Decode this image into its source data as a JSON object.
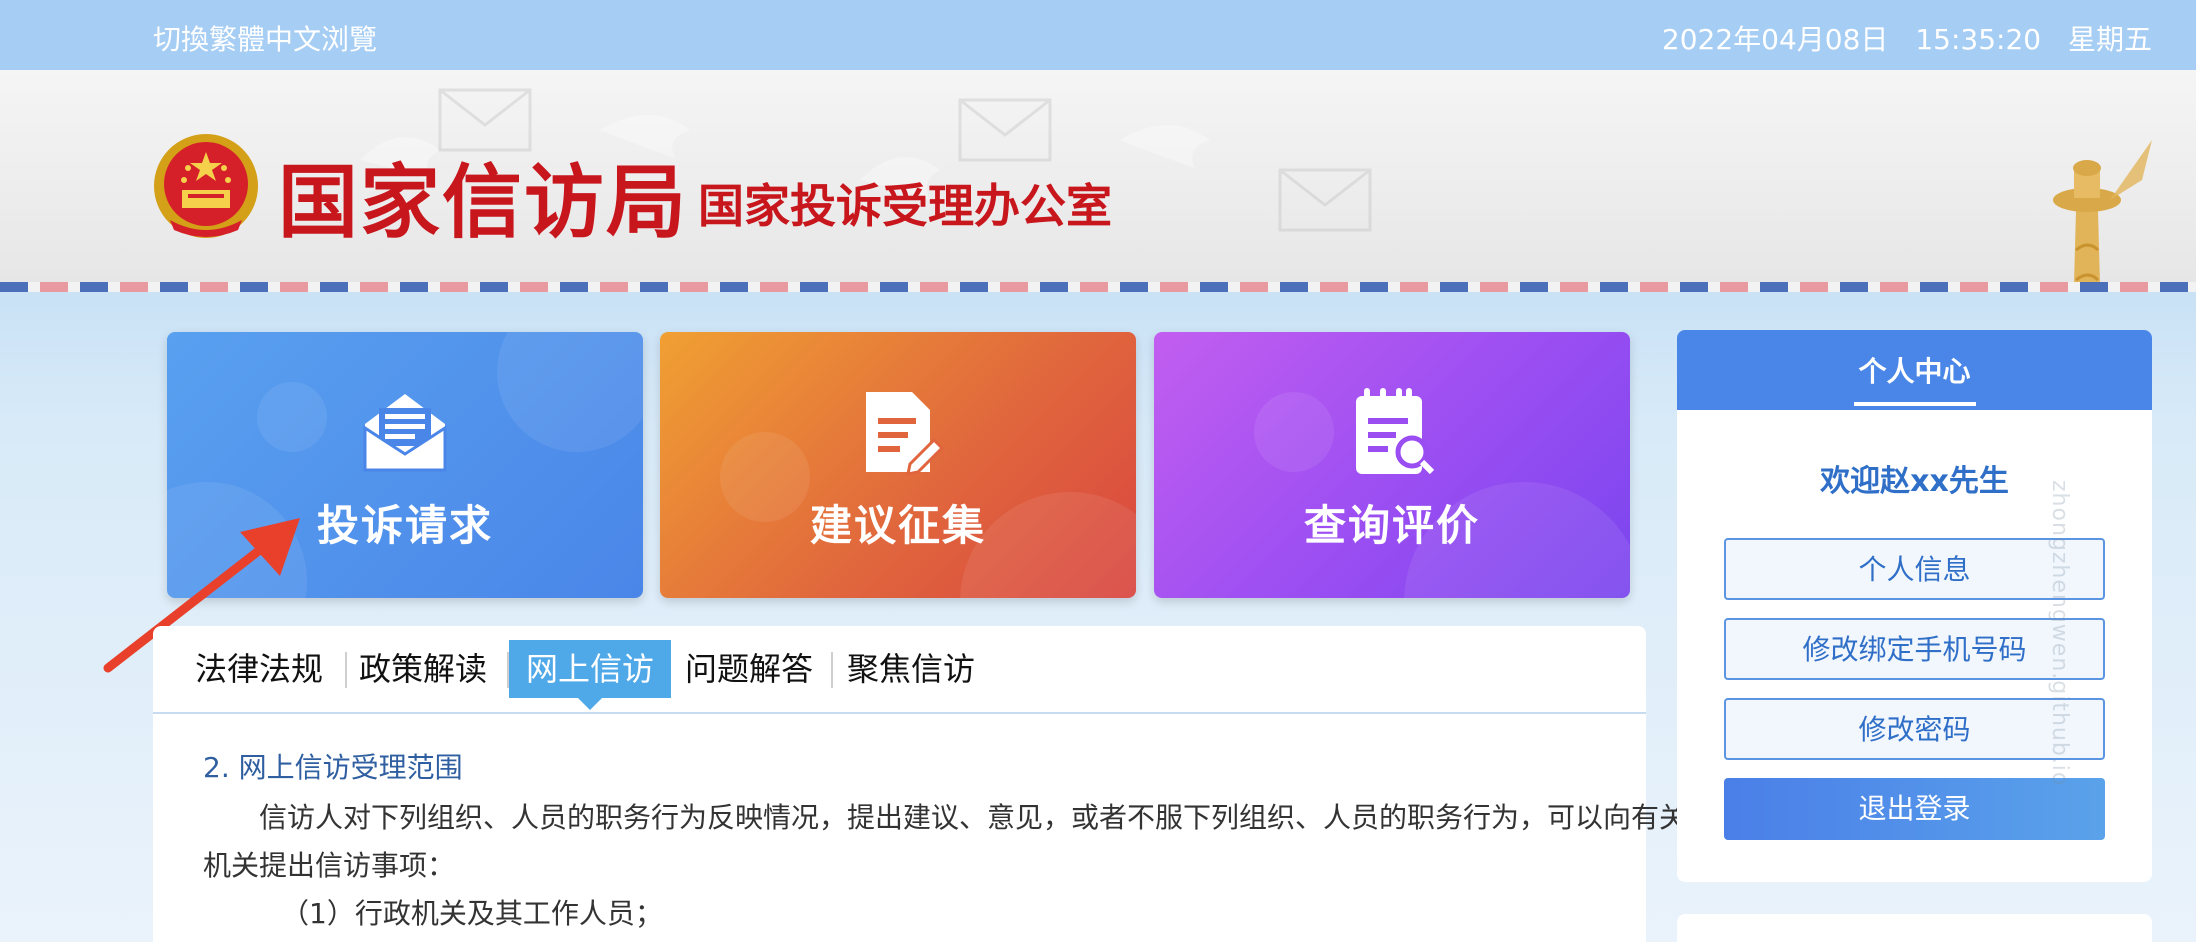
{
  "topbar": {
    "lang_switch": "切換繁體中文浏覽",
    "date": "2022年04月08日",
    "time": "15:35:20",
    "weekday": "星期五"
  },
  "banner": {
    "title": "国家信访局",
    "subtitle": "国家投诉受理办公室"
  },
  "tiles": [
    {
      "label": "投诉请求",
      "icon": "envelope-icon",
      "color": "#4a86e8"
    },
    {
      "label": "建议征集",
      "icon": "document-edit-icon",
      "color": "#e0653d"
    },
    {
      "label": "查询评价",
      "icon": "calendar-search-icon",
      "color": "#9a4ef2"
    }
  ],
  "tabs": [
    {
      "label": "法律法规",
      "active": false
    },
    {
      "label": "政策解读",
      "active": false
    },
    {
      "label": "网上信访",
      "active": true
    },
    {
      "label": "问题解答",
      "active": false
    },
    {
      "label": "聚焦信访",
      "active": false
    }
  ],
  "content": {
    "section_title": "2.  网上信访受理范围",
    "paragraph": "信访人对下列组织、人员的职务行为反映情况，提出建议、意见，或者不服下列组织、人员的职务行为，可以向有关行政机关提出信访事项：",
    "item1": "（1）行政机关及其工作人员；"
  },
  "side_panel": {
    "title": "个人中心",
    "welcome": "欢迎赵xx先生",
    "buttons": {
      "profile": "个人信息",
      "change_phone": "修改绑定手机号码",
      "change_password": "修改密码",
      "logout": "退出登录"
    }
  },
  "watermark": "zhongzhengwen.github.io",
  "colors": {
    "accent_blue": "#4a86e8",
    "title_red": "#c8161d",
    "active_tab": "#4fa8e8",
    "arrow_red": "#e8402a"
  }
}
